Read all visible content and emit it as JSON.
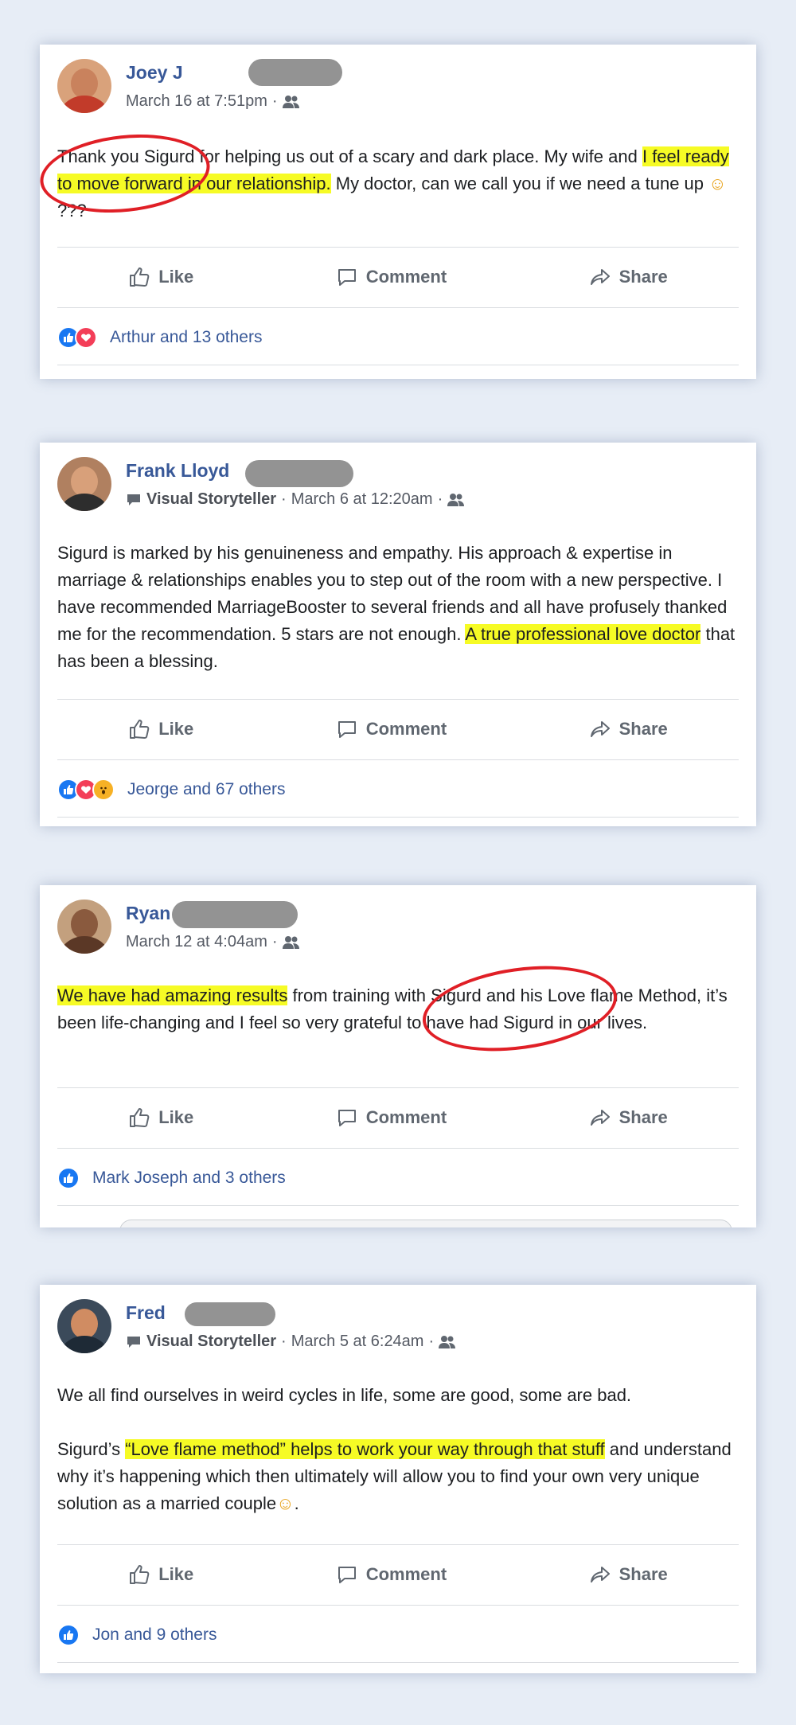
{
  "posts": [
    {
      "author": "Joey J",
      "date": "March 16 at 7:51pm",
      "text_parts": [
        {
          "text": "Thank you Sigurd for helping us out of a scary and dark place. My wife and ",
          "hl": false
        },
        {
          "text": "I feel ready to move forward in our relationship.",
          "hl": true
        },
        {
          "text": " My doctor, can we call you if we need a tune up ",
          "hl": false
        },
        {
          "text": "☺",
          "hl": false
        },
        {
          "text": " ???",
          "hl": false
        }
      ],
      "reactions_text": "Arthur and 13 others"
    },
    {
      "author": "Frank Lloyd",
      "badge": "Visual Storyteller",
      "date": "March 6 at 12:20am",
      "text_parts": [
        {
          "text": "Sigurd is marked by his genuineness and empathy. His approach & expertise in marriage & relationships enables you to step out of the room with a new perspective. I have recommended MarriageBooster to several friends and all have profusely thanked me for the recommendation. 5 stars are not enough. ",
          "hl": false
        },
        {
          "text": "A true professional love doctor",
          "hl": true
        },
        {
          "text": " that has been a blessing.",
          "hl": false
        }
      ],
      "reactions_text": "Jeorge and 67 others"
    },
    {
      "author": "Ryan",
      "date": "March 12 at 4:04am",
      "text_parts": [
        {
          "text": "We have had amazing results",
          "hl": true
        },
        {
          "text": " from training with Sigurd and his Love flame Method, it’s been life-changing and I feel so very grateful to have had Sigurd in our lives.",
          "hl": false
        }
      ],
      "reactions_text": "Mark Joseph and 3 others"
    },
    {
      "author": "Fred",
      "badge": "Visual Storyteller",
      "date": "March 5 at 6:24am",
      "text_parts": [
        {
          "text": "We all find ourselves in weird cycles in life, some are good, some are bad.",
          "hl": false,
          "br_after": true
        },
        {
          "text": "Sigurd’s ",
          "hl": false
        },
        {
          "text": "“Love flame method” helps to work your way through that stuff",
          "hl": true
        },
        {
          "text": " and understand why it’s happening which then ultimately will allow you to find your own very unique solution as a married couple",
          "hl": false
        },
        {
          "text": "☺",
          "hl": false
        },
        {
          "text": ".",
          "hl": false
        }
      ],
      "reactions_text": "Jon and 9 others"
    }
  ],
  "actions": {
    "like": "Like",
    "comment": "Comment",
    "share": "Share"
  },
  "colors": {
    "highlight": "#f6fb25",
    "link": "#385898",
    "annotation": "#e01f26"
  }
}
